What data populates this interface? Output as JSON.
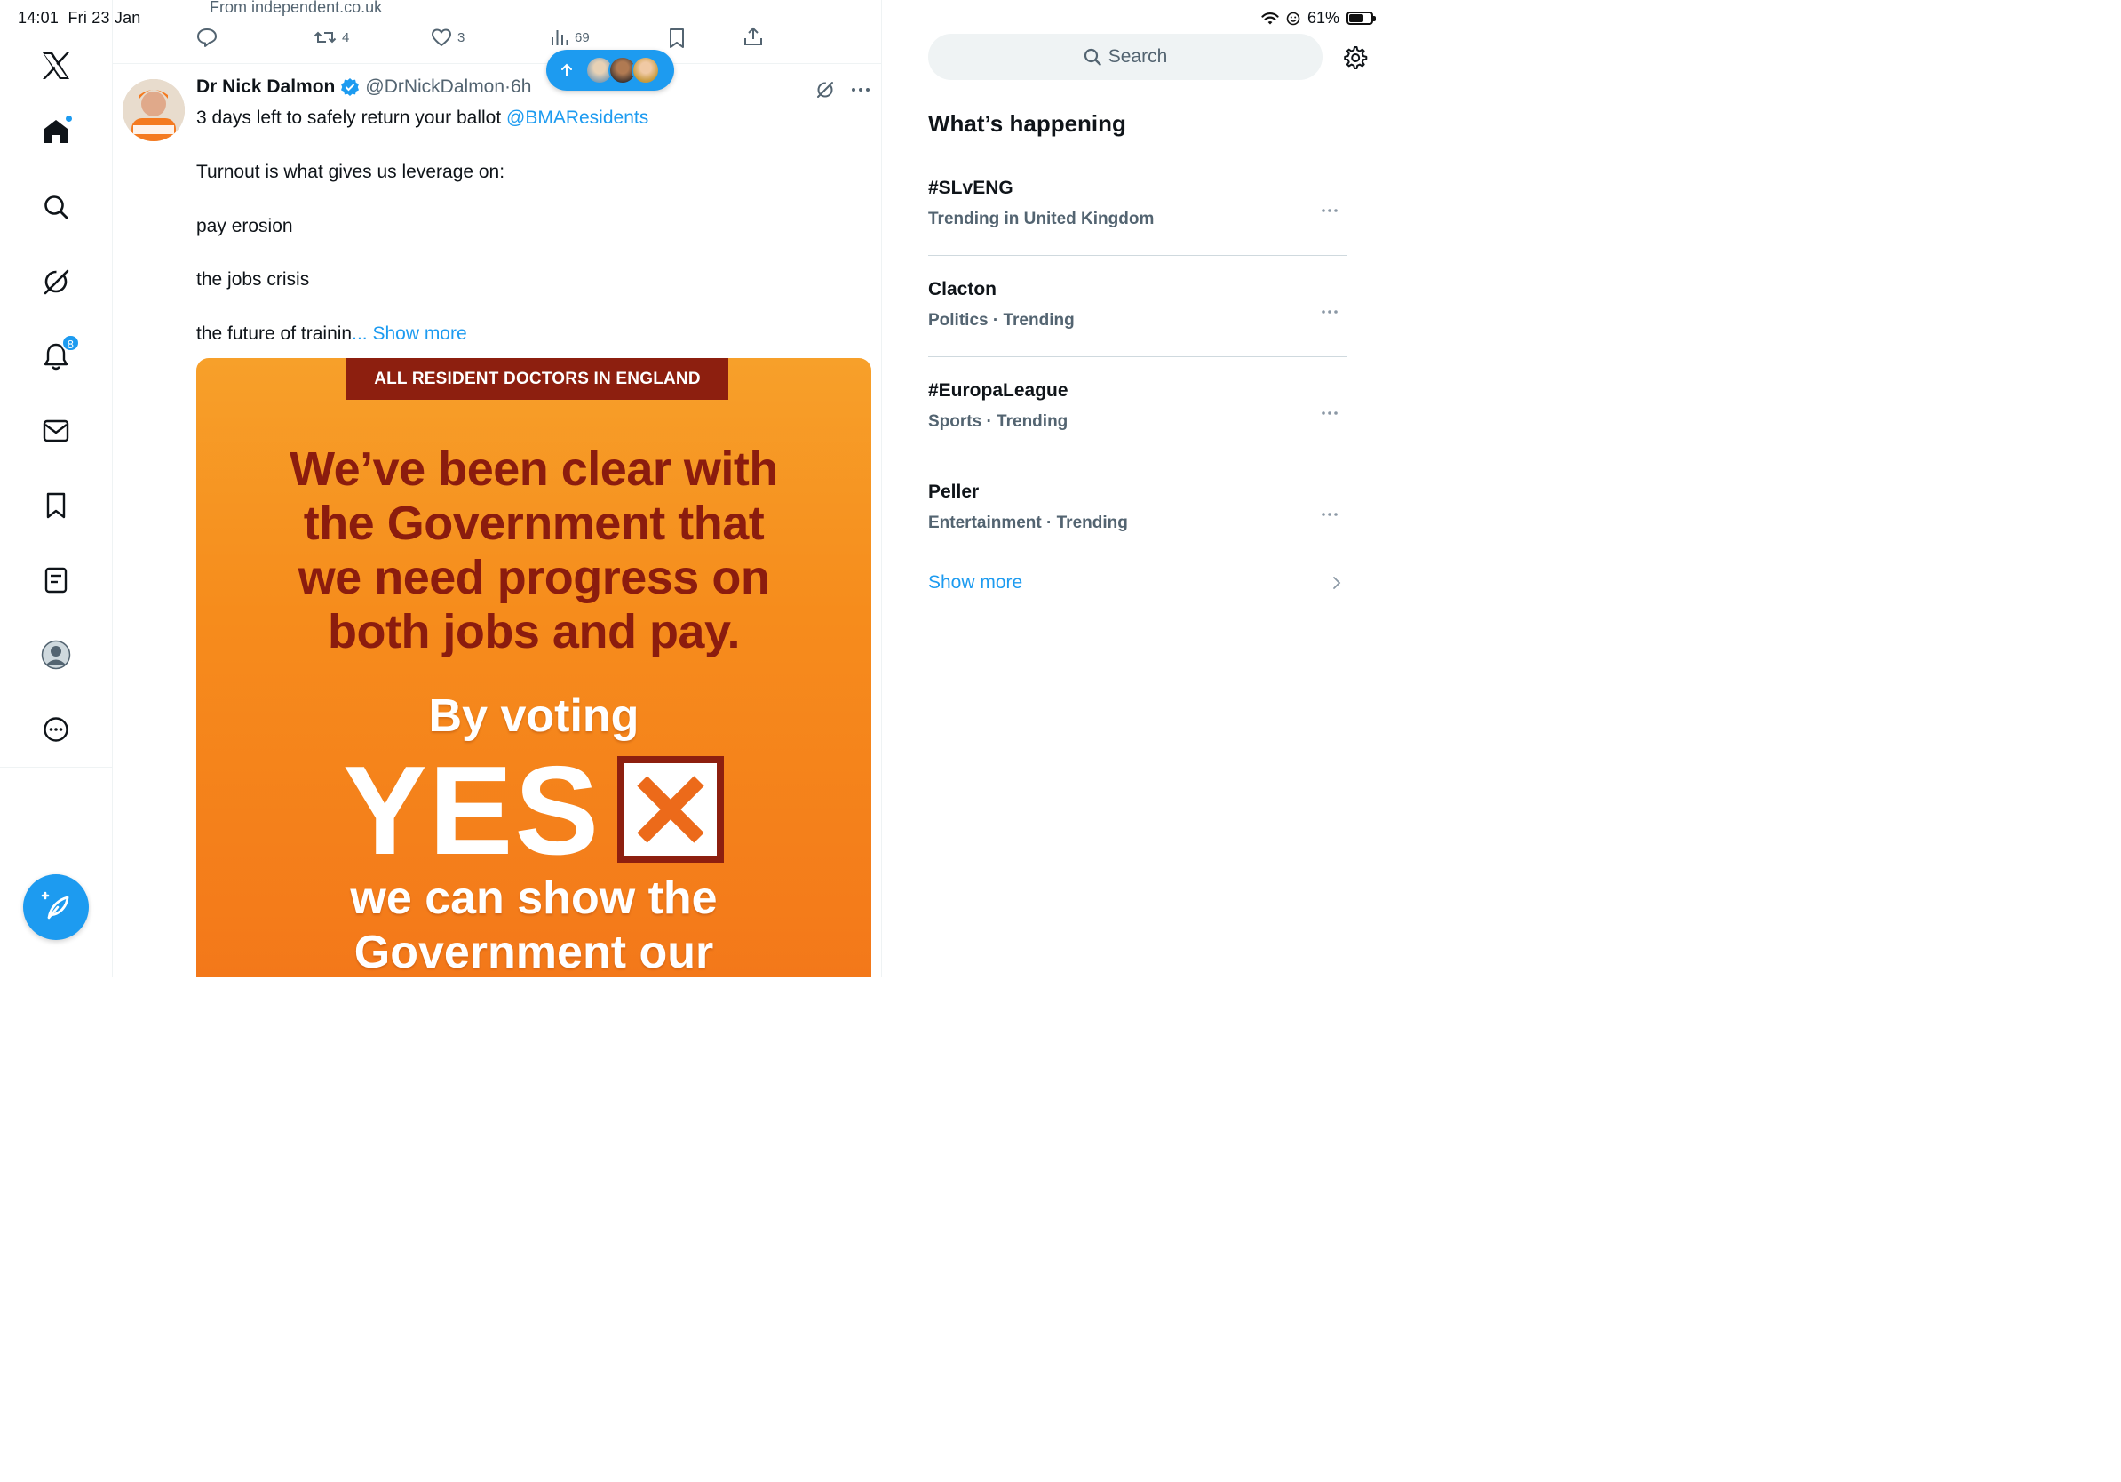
{
  "status_bar": {
    "time": "14:01",
    "date": "Fri 23 Jan",
    "battery": "61%",
    "battery_level": 0.61
  },
  "sidebar": {
    "items": [
      {
        "icon": "x-logo-icon"
      },
      {
        "icon": "home-icon",
        "has_dot": true
      },
      {
        "icon": "search-icon"
      },
      {
        "icon": "grok-icon"
      },
      {
        "icon": "bell-icon",
        "badge": "8"
      },
      {
        "icon": "mail-icon"
      },
      {
        "icon": "bookmark-icon"
      },
      {
        "icon": "lists-icon"
      },
      {
        "icon": "profile-icon"
      },
      {
        "icon": "more-icon"
      }
    ],
    "compose_icon": "compose-feather-icon"
  },
  "feed": {
    "previous_post": {
      "source": "From independent.co.uk",
      "replies": "",
      "reposts": "4",
      "likes": "3",
      "views": "69"
    },
    "post": {
      "author_name": "Dr Nick Dalmon",
      "author_handle": "@DrNickDalmon·6h",
      "verified": true,
      "line1_text": "3 days left to safely return your ballot ",
      "line1_mention": "@BMAResidents",
      "line2": "Turnout is what gives us leverage on:",
      "line3": "pay erosion",
      "line4": "the jobs crisis",
      "line5_text": "the future of trainin",
      "line5_more": "... Show more",
      "media": {
        "banner": "ALL RESIDENT DOCTORS IN ENGLAND",
        "headline_lines": [
          "We’ve been clear with",
          "the Government that",
          "we need progress on",
          "both jobs and pay."
        ],
        "voting": "By voting",
        "yes": "YES",
        "bottom_lines": [
          "we can show the",
          "Government our"
        ]
      }
    }
  },
  "right_panel": {
    "search_placeholder": "Search",
    "section_title": "What’s happening",
    "trends": [
      {
        "name": "#SLvENG",
        "meta": "Trending in United Kingdom"
      },
      {
        "name": "Clacton",
        "meta": "Politics · Trending"
      },
      {
        "name": "#EuropaLeague",
        "meta": "Sports · Trending"
      },
      {
        "name": "Peller",
        "meta": "Entertainment · Trending"
      }
    ],
    "show_more": "Show more"
  },
  "colors": {
    "accent": "#1d9bf0",
    "text_primary": "#0f1419",
    "text_secondary": "#536471",
    "media_orange": "#f68c1c",
    "media_dark_red": "#8d1f0f"
  }
}
